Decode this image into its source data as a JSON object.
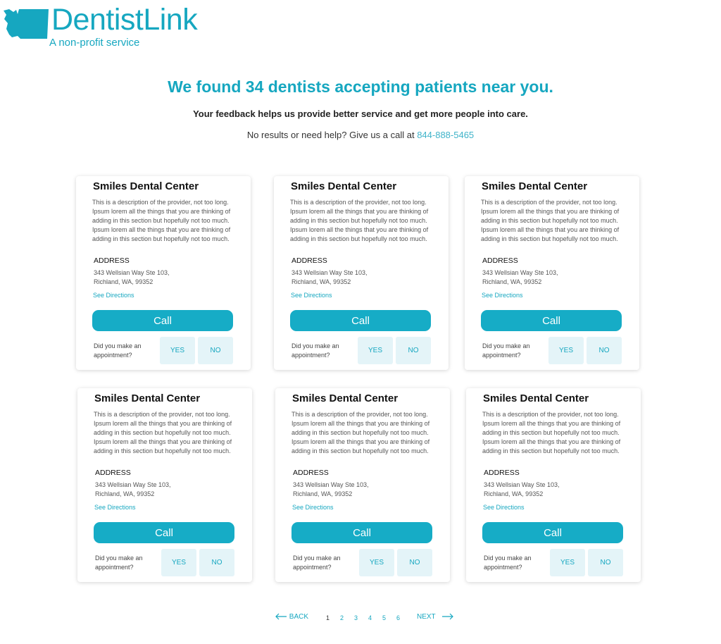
{
  "brand": {
    "name": "DentistLink",
    "tagline": "A non-profit service",
    "color": "#16a7c0"
  },
  "hero": {
    "headline": "We found 34 dentists accepting patients near you.",
    "feedback": "Your feedback helps us provide better service and get more people into care.",
    "help_text": "No results or need help? Give us a call at",
    "phone": "844-888-5465"
  },
  "cards": [
    {
      "name": "Smiles Dental Center",
      "description": "This is a description of the provider, not too long. Ipsum lorem all the things that you are thinking of adding in this section but hopefully not too much. Ipsum lorem all the things that you are thinking of adding in this section but hopefully not too much.",
      "address_label": "ADDRESS",
      "address_line1": "343 Wellsian Way Ste 103,",
      "address_line2": "Richland, WA, 99352",
      "directions": "See Directions",
      "call": "Call",
      "question": "Did you make an appointment?",
      "yes": "YES",
      "no": "NO"
    },
    {
      "name": "Smiles Dental Center",
      "description": "This is a description of the provider, not too long. Ipsum lorem all the things that you are thinking of adding in this section but hopefully not too much. Ipsum lorem all the things that you are thinking of adding in this section but hopefully not too much.",
      "address_label": "ADDRESS",
      "address_line1": "343 Wellsian Way Ste 103,",
      "address_line2": "Richland, WA, 99352",
      "directions": "See Directions",
      "call": "Call",
      "question": "Did you make an appointment?",
      "yes": "YES",
      "no": "NO"
    },
    {
      "name": "Smiles Dental Center",
      "description": "This is a description of the provider, not too long. Ipsum lorem all the things that you are thinking of adding in this section but hopefully not too much. Ipsum lorem all the things that you are thinking of adding in this section but hopefully not too much.",
      "address_label": "ADDRESS",
      "address_line1": "343 Wellsian Way Ste 103,",
      "address_line2": "Richland, WA, 99352",
      "directions": "See Directions",
      "call": "Call",
      "question": "Did you make an appointment?",
      "yes": "YES",
      "no": "NO"
    },
    {
      "name": "Smiles Dental Center",
      "description": "This is a description of the provider, not too long. Ipsum lorem all the things that you are thinking of adding in this section but hopefully not too much. Ipsum lorem all the things that you are thinking of adding in this section but hopefully not too much.",
      "address_label": "ADDRESS",
      "address_line1": "343 Wellsian Way Ste 103,",
      "address_line2": "Richland, WA, 99352",
      "directions": "See Directions",
      "call": "Call",
      "question": "Did you make an appointment?",
      "yes": "YES",
      "no": "NO"
    },
    {
      "name": "Smiles Dental Center",
      "description": "This is a description of the provider, not too long. Ipsum lorem all the things that you are thinking of adding in this section but hopefully not too much. Ipsum lorem all the things that you are thinking of adding in this section but hopefully not too much.",
      "address_label": "ADDRESS",
      "address_line1": "343 Wellsian Way Ste 103,",
      "address_line2": "Richland, WA, 99352",
      "directions": "See Directions",
      "call": "Call",
      "question": "Did you make an appointment?",
      "yes": "YES",
      "no": "NO"
    },
    {
      "name": "Smiles Dental Center",
      "description": "This is a description of the provider, not too long. Ipsum lorem all the things that you are thinking of adding in this section but hopefully not too much. Ipsum lorem all the things that you are thinking of adding in this section but hopefully not too much.",
      "address_label": "ADDRESS",
      "address_line1": "343 Wellsian Way Ste 103,",
      "address_line2": "Richland, WA, 99352",
      "directions": "See Directions",
      "call": "Call",
      "question": "Did you make an appointment?",
      "yes": "YES",
      "no": "NO"
    }
  ],
  "pagination": {
    "back": "BACK",
    "next": "NEXT",
    "pages": [
      "1",
      "2",
      "3",
      "4",
      "5",
      "6"
    ],
    "current_page": "1",
    "back_icon": "arrow-left-icon",
    "next_icon": "arrow-right-icon"
  },
  "colors": {
    "accent": "#16a7c0",
    "button": "#16acc6",
    "answer_bg": "#e4f4f8"
  }
}
